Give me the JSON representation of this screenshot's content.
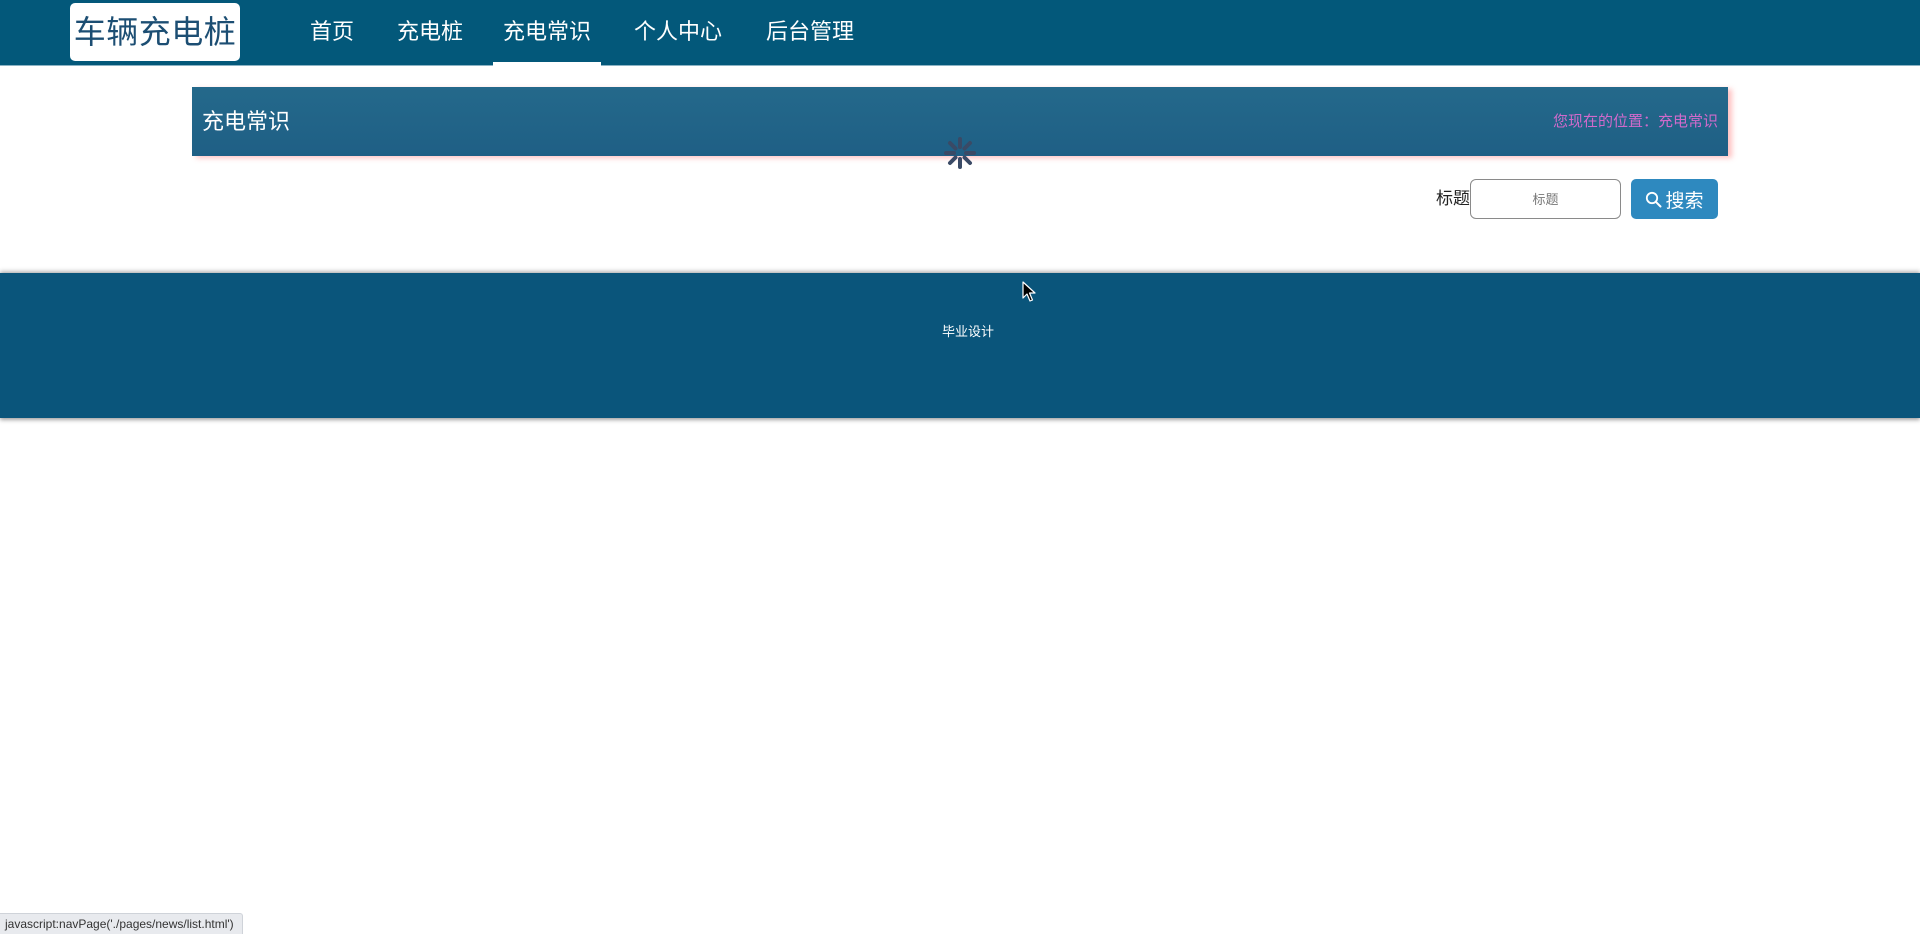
{
  "header": {
    "brand": "车辆充电桩",
    "nav": [
      {
        "label": "首页"
      },
      {
        "label": "充电桩"
      },
      {
        "label": "充电常识",
        "active": true
      },
      {
        "label": "个人中心"
      },
      {
        "label": "后台管理"
      }
    ]
  },
  "banner": {
    "title": "充电常识",
    "breadcrumb": "您现在的位置：充电常识"
  },
  "search": {
    "label": "标题",
    "placeholder": "标题",
    "value": "",
    "button_label": "搜索"
  },
  "footer": {
    "text": "毕业设计"
  },
  "statusbar": {
    "text": "javascript:navPage('./pages/news/list.html')"
  },
  "colors": {
    "nav_bg": "#03587a",
    "banner_bg": "#236589",
    "breadcrumb": "#d06acb",
    "button_bg": "#2e89bf",
    "footer_bg": "#0a557b"
  },
  "icons": {
    "loading": "loading-spinner-icon",
    "search": "search-icon",
    "cursor": "mouse-cursor-icon"
  }
}
